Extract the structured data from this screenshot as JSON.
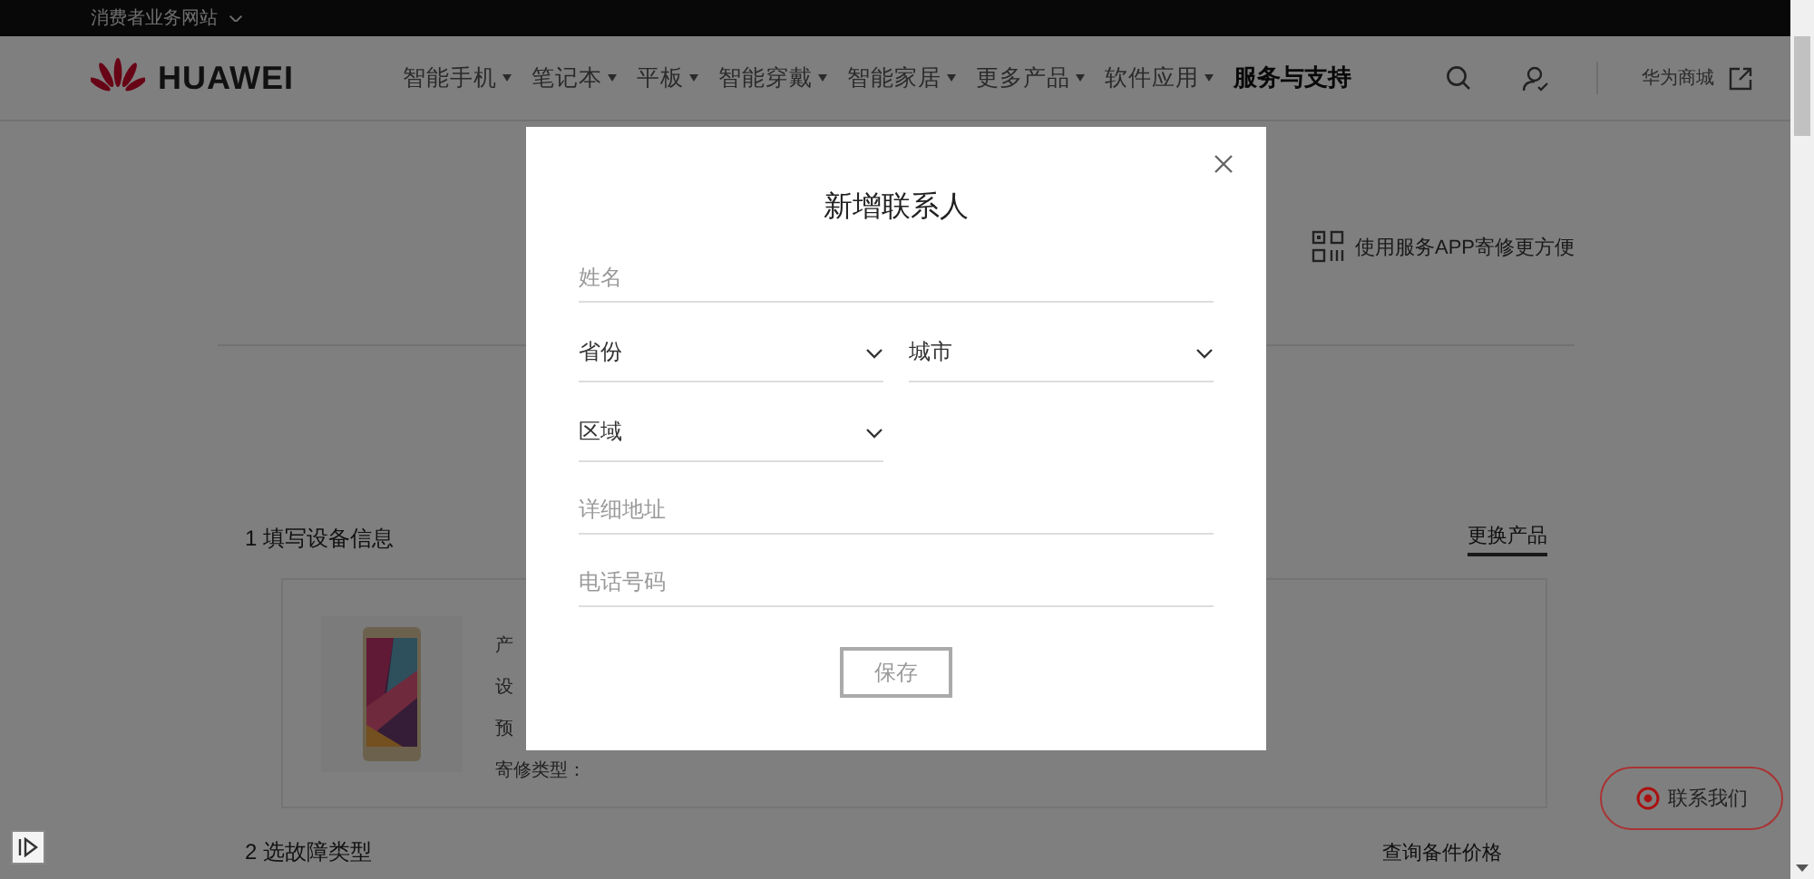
{
  "top_bar": {
    "site_link": "消费者业务网站"
  },
  "header": {
    "logo": "HUAWEI",
    "nav": [
      {
        "label": "智能手机",
        "dropdown": true,
        "selected": false
      },
      {
        "label": "笔记本",
        "dropdown": true,
        "selected": false
      },
      {
        "label": "平板",
        "dropdown": true,
        "selected": false
      },
      {
        "label": "智能穿戴",
        "dropdown": true,
        "selected": false
      },
      {
        "label": "智能家居",
        "dropdown": true,
        "selected": false
      },
      {
        "label": "更多产品",
        "dropdown": true,
        "selected": false
      },
      {
        "label": "软件应用",
        "dropdown": true,
        "selected": false
      },
      {
        "label": "服务与支持",
        "dropdown": false,
        "selected": true
      }
    ],
    "store_link": "华为商城"
  },
  "app_promo": "使用服务APP寄修更方便",
  "step1": {
    "title": "1 填写设备信息",
    "change_link": "更换产品",
    "device": {
      "kind": "picture",
      "lines": [
        "产",
        "设",
        "预",
        "寄修类型："
      ]
    }
  },
  "step2": {
    "title": "2 选故障类型",
    "link": "查询备件价格"
  },
  "contact_button": "联系我们",
  "dialog": {
    "title": "新增联系人",
    "fields": [
      {
        "kind": "input",
        "placeholder": "姓名"
      },
      {
        "kind": "select",
        "placeholder": "省份"
      },
      {
        "kind": "select",
        "placeholder": "城市"
      },
      {
        "kind": "select",
        "placeholder": "区域"
      },
      {
        "kind": "input",
        "placeholder": "详细地址"
      },
      {
        "kind": "input",
        "placeholder": "电话号码"
      }
    ],
    "save_button": "保存"
  }
}
